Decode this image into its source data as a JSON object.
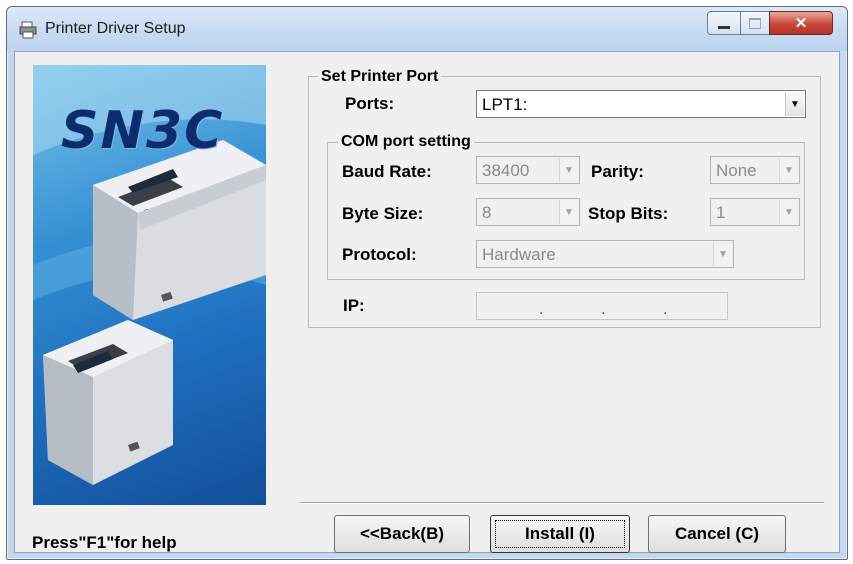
{
  "window": {
    "title": "Printer Driver Setup",
    "controls": {
      "minimize": "–",
      "maximize": "□",
      "close": "✕"
    }
  },
  "banner": {
    "logo": "SN3C"
  },
  "port_group": {
    "title": "Set Printer Port",
    "ports_label": "Ports:",
    "ports_value": "LPT1:"
  },
  "com_group": {
    "title": "COM port setting",
    "baud_label": "Baud Rate:",
    "baud_value": "38400",
    "parity_label": "Parity:",
    "parity_value": "None",
    "bytesize_label": "Byte Size:",
    "bytesize_value": "8",
    "stopbits_label": "Stop Bits:",
    "stopbits_value": "1",
    "protocol_label": "Protocol:",
    "protocol_value": "Hardware"
  },
  "ip": {
    "label": "IP:",
    "dot": "."
  },
  "buttons": {
    "back": "<<Back(B)",
    "install": "Install (I)",
    "cancel": "Cancel (C)"
  },
  "status": {
    "help": "Press\"F1\"for help"
  },
  "icons": {
    "dropdown": "▼"
  }
}
